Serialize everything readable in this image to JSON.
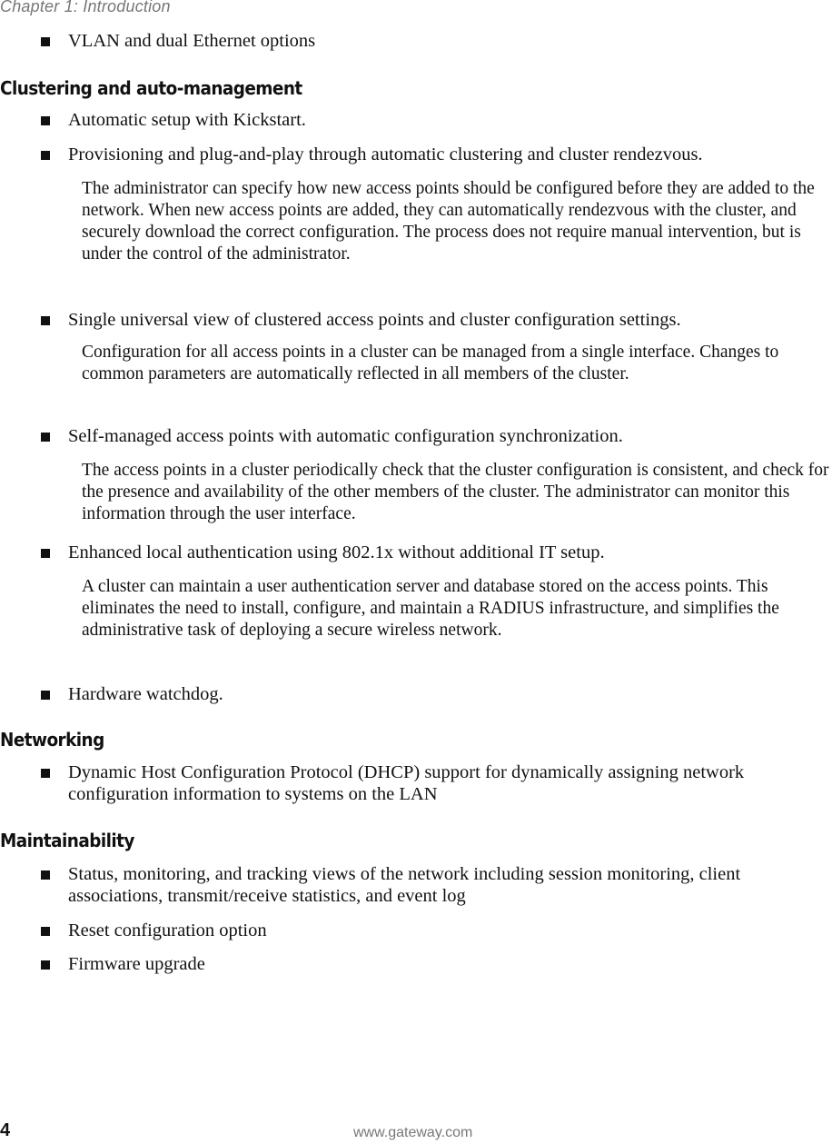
{
  "header": {
    "running_head": "Chapter 1: Introduction"
  },
  "intro_items": [
    {
      "text": "VLAN and dual Ethernet options"
    }
  ],
  "sections": [
    {
      "heading": "Clustering and auto-management",
      "items": [
        {
          "text": "Automatic setup with Kickstart."
        },
        {
          "text": "Provisioning and plug-and-play through automatic clustering and cluster rendezvous.",
          "detail": "The administrator can specify how new access points should be configured before they are added to the network. When new access points are added, they can automatically rendezvous with the cluster, and securely download the correct configuration. The process does not require manual intervention, but is under the control of the administrator."
        },
        {
          "text": "Single universal view of clustered access points and cluster configuration settings.",
          "detail": "Configuration for all access points in a cluster can be managed from a single interface. Changes to common parameters are automatically reflected in all members of the cluster."
        },
        {
          "text": "Self-managed access points with automatic configuration synchronization.",
          "detail": "The access points in a cluster periodically check that the cluster configuration is consistent, and check for the presence and availability of the other members of the cluster. The administrator can monitor this information through the user interface."
        },
        {
          "text": "Enhanced local authentication using 802.1x without additional IT setup.",
          "detail": "A cluster can maintain a user authentication server and database stored on the access points. This eliminates the need to install, configure, and maintain a RADIUS infrastructure, and simplifies the administrative task of deploying a secure wireless network."
        },
        {
          "text": "Hardware watchdog."
        }
      ]
    },
    {
      "heading": "Networking",
      "items": [
        {
          "text": "Dynamic Host Configuration Protocol (DHCP) support for dynamically assigning network configuration information to systems on the LAN"
        }
      ]
    },
    {
      "heading": "Maintainability",
      "items": [
        {
          "text": "Status, monitoring, and tracking views of the network including session monitoring, client associations, transmit/receive statistics, and event log"
        },
        {
          "text": "Reset configuration option"
        },
        {
          "text": "Firmware upgrade"
        }
      ]
    }
  ],
  "footer": {
    "page_number": "4",
    "url": "www.gateway.com"
  }
}
